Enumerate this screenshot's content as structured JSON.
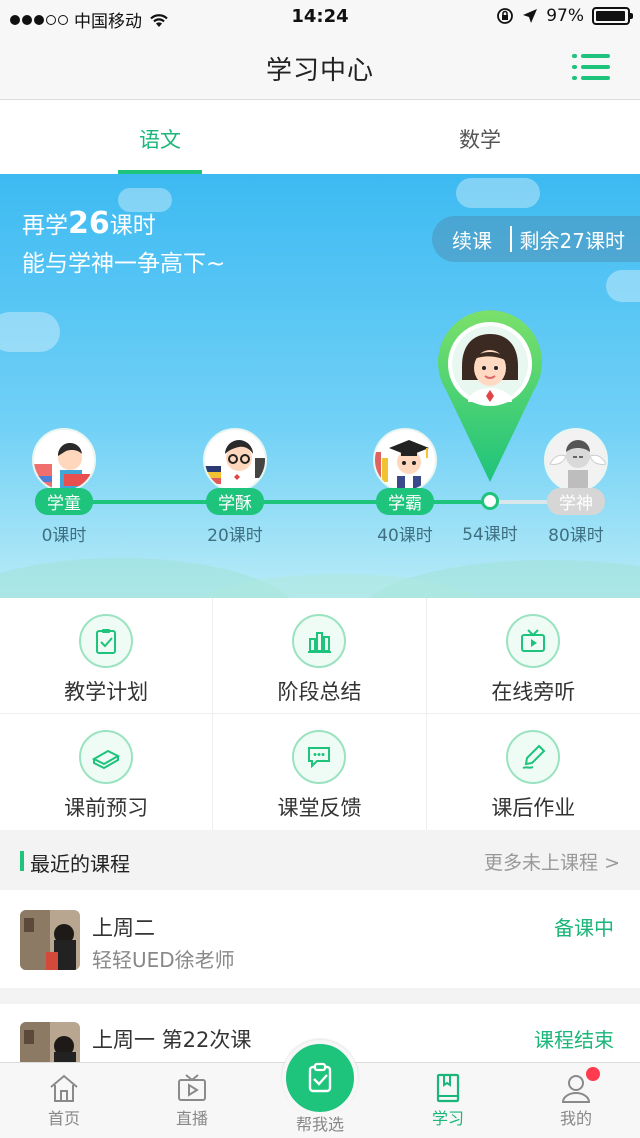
{
  "status_bar": {
    "carrier": "中国移动",
    "time": "14:24",
    "battery": "97%",
    "battery_level": 0.97
  },
  "header": {
    "title": "学习中心"
  },
  "subject_tabs": [
    {
      "label": "语文",
      "active": true
    },
    {
      "label": "数学",
      "active": false
    }
  ],
  "hero": {
    "line1_prefix": "再学",
    "line1_number": "26",
    "line1_suffix": "课时",
    "line2": "能与学神一争高下~",
    "continue_label": "续课",
    "remaining": "剩余27课时",
    "current_hours": "54课时",
    "milestones": [
      {
        "title": "学童",
        "hours": "0课时",
        "reached": true
      },
      {
        "title": "学酥",
        "hours": "20课时",
        "reached": true
      },
      {
        "title": "学霸",
        "hours": "40课时",
        "reached": true
      },
      {
        "title": "学神",
        "hours": "80课时",
        "reached": false
      }
    ]
  },
  "features": [
    {
      "label": "教学计划",
      "icon": "clipboard-check-icon"
    },
    {
      "label": "阶段总结",
      "icon": "bar-chart-icon"
    },
    {
      "label": "在线旁听",
      "icon": "tv-play-icon"
    },
    {
      "label": "课前预习",
      "icon": "book-icon"
    },
    {
      "label": "课堂反馈",
      "icon": "chat-bubbles-icon"
    },
    {
      "label": "课后作业",
      "icon": "pen-icon"
    }
  ],
  "recent": {
    "title": "最近的课程",
    "more": "更多未上课程 >",
    "courses": [
      {
        "line1": "上周二",
        "line2": "轻轻UED徐老师",
        "status": "备课中"
      },
      {
        "line1": "上周一 第22次课",
        "line2": "",
        "status": "课程结束"
      }
    ]
  },
  "tabbar": [
    {
      "label": "首页",
      "icon": "home-icon",
      "active": false
    },
    {
      "label": "直播",
      "icon": "live-tv-icon",
      "active": false
    },
    {
      "label": "帮我选",
      "icon": "clipboard-check-icon",
      "active": false
    },
    {
      "label": "学习",
      "icon": "book-bookmark-icon",
      "active": true
    },
    {
      "label": "我的",
      "icon": "user-icon",
      "active": false
    }
  ],
  "colors": {
    "accent": "#1ec37c",
    "sky": "#3dbaf2",
    "status_green": "#1ab67a"
  }
}
